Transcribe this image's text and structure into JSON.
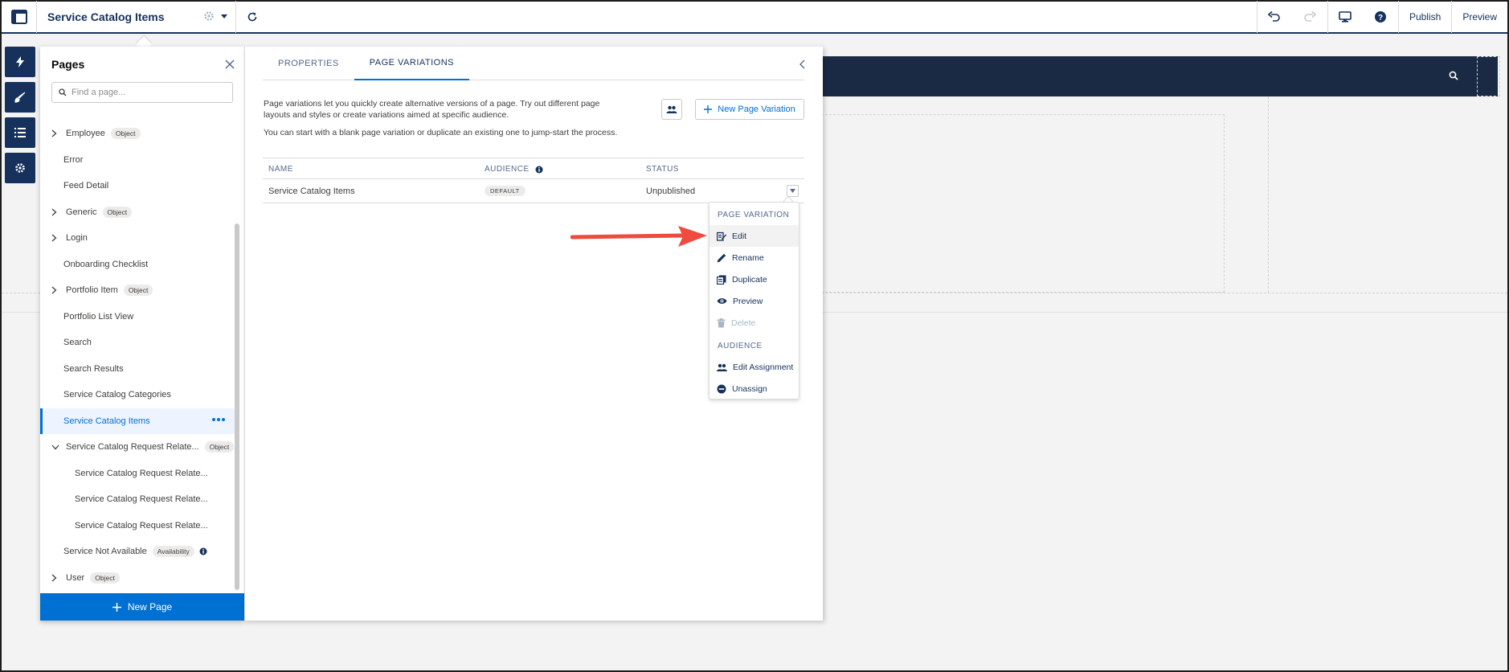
{
  "topbar": {
    "title": "Service Catalog Items",
    "publish_label": "Publish",
    "preview_label": "Preview"
  },
  "pages_panel": {
    "title": "Pages",
    "search_placeholder": "Find a page...",
    "new_page_label": "New Page",
    "items": [
      {
        "label": "Employee",
        "badge": "Object"
      },
      {
        "label": "Error"
      },
      {
        "label": "Feed Detail"
      },
      {
        "label": "Generic",
        "badge": "Object"
      },
      {
        "label": "Login"
      },
      {
        "label": "Onboarding Checklist"
      },
      {
        "label": "Portfolio Item",
        "badge": "Object"
      },
      {
        "label": "Portfolio List View"
      },
      {
        "label": "Search"
      },
      {
        "label": "Search Results"
      },
      {
        "label": "Service Catalog Categories"
      },
      {
        "label": "Service Catalog Items"
      },
      {
        "label": "Service Catalog Request Relate...",
        "badge": "Object"
      },
      {
        "label": "Service Catalog Request Relate..."
      },
      {
        "label": "Service Catalog Request Relate..."
      },
      {
        "label": "Service Catalog Request Relate..."
      },
      {
        "label": "Service Not Available",
        "badge": "Availability"
      },
      {
        "label": "User",
        "badge": "Object"
      }
    ]
  },
  "props_panel": {
    "tabs": [
      "PROPERTIES",
      "PAGE VARIATIONS"
    ],
    "active_tab": "PAGE VARIATIONS",
    "description": "Page variations let you quickly create alternative versions of a page. Try out different page layouts and styles or create variations aimed at specific audience.",
    "description2": "You can start with a blank page variation or duplicate an existing one to jump-start the process.",
    "new_variation_label": "New Page Variation",
    "table": {
      "headers": [
        "NAME",
        "AUDIENCE",
        "STATUS"
      ],
      "rows": [
        {
          "name": "Service Catalog Items",
          "audience": "DEFAULT",
          "status": "Unpublished"
        }
      ]
    },
    "menu": {
      "section1": "PAGE VARIATION",
      "edit": "Edit",
      "rename": "Rename",
      "duplicate": "Duplicate",
      "preview": "Preview",
      "delete": "Delete",
      "section2": "AUDIENCE",
      "edit_assignment": "Edit Assignment",
      "unassign": "Unassign"
    }
  },
  "colors": {
    "brand": "#0070d2",
    "navy": "#16325c",
    "annotation_arrow": "#ef4b3f"
  }
}
